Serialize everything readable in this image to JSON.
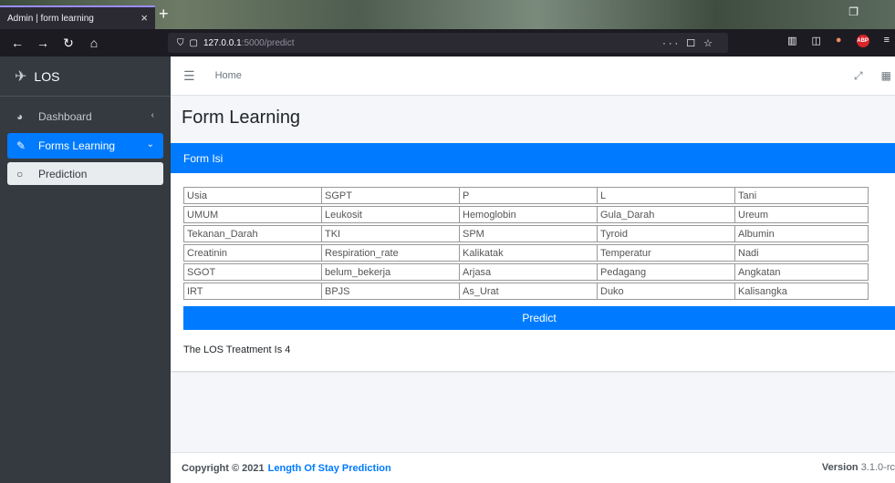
{
  "browser": {
    "tab_title": "Admin | form learning",
    "tab_close": "×",
    "new_tab": "+",
    "url_host": "127.0.0.1",
    "url_path": ":5000/predict",
    "url_actions": "··· ☐ ☆"
  },
  "sidebar": {
    "brand": "LOS",
    "items": [
      {
        "label": "Dashboard"
      },
      {
        "label": "Forms Learning"
      },
      {
        "label": "Prediction"
      }
    ]
  },
  "topnav": {
    "home": "Home"
  },
  "page": {
    "title": "Form Learning"
  },
  "card": {
    "header": "Form Isi",
    "fields": [
      "Usia",
      "SGPT",
      "P",
      "L",
      "Tani",
      "UMUM",
      "Leukosit",
      "Hemoglobin",
      "Gula_Darah",
      "Ureum",
      "Tekanan_Darah",
      "TKI",
      "SPM",
      "Tyroid",
      "Albumin",
      "Creatinin",
      "Respiration_rate",
      "Kalikatak",
      "Temperatur",
      "Nadi",
      "SGOT",
      "belum_bekerja",
      "Arjasa",
      "Pedagang",
      "Angkatan",
      "IRT",
      "BPJS",
      "As_Urat",
      "Duko",
      "Kalisangka"
    ],
    "predict_label": "Predict",
    "result": "The LOS Treatment Is 4"
  },
  "footer": {
    "copyright": "Copyright © 2021",
    "link": "Length Of Stay Prediction",
    "version_label": "Version",
    "version_value": "3.1.0-rc"
  },
  "colors": {
    "primary": "#007bff",
    "sidebar_bg": "#343a40"
  }
}
